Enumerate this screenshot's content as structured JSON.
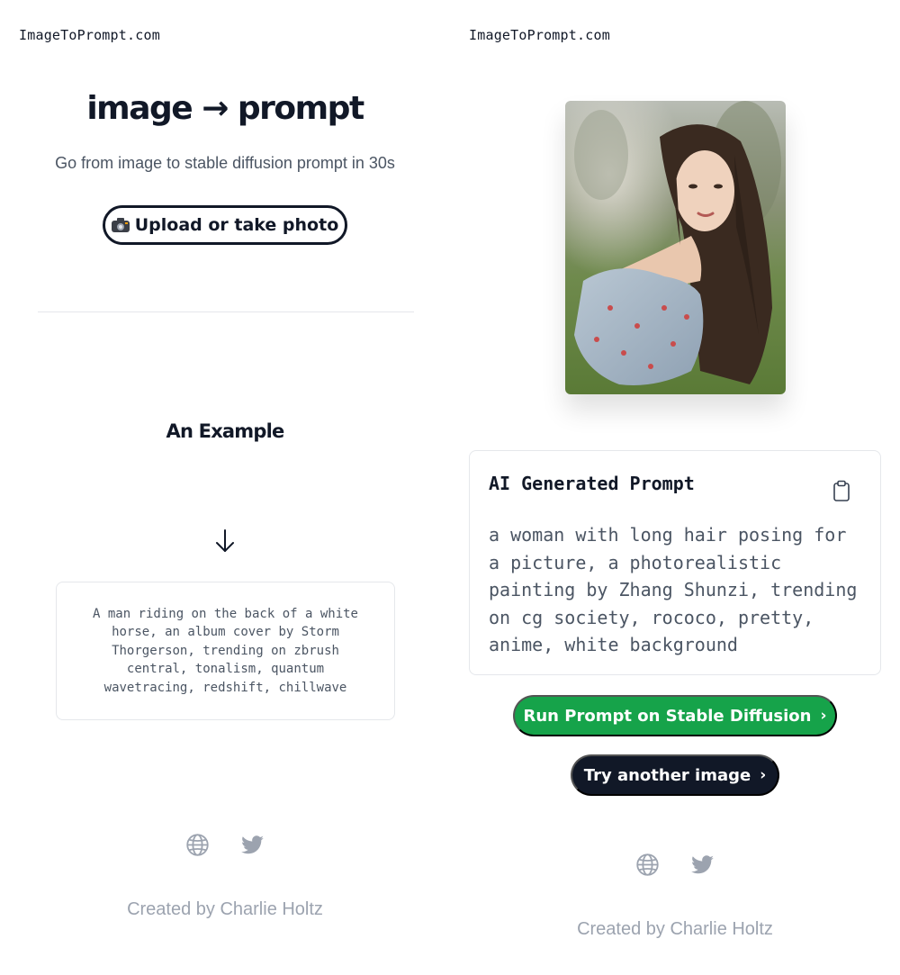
{
  "left": {
    "brand": "ImageToPrompt.com",
    "hero": {
      "title": "image → prompt",
      "subtitle": "Go from image to stable diffusion prompt in 30s",
      "upload_label": "Upload or take photo",
      "upload_icon": "camera-icon"
    },
    "example": {
      "heading": "An Example",
      "arrow_icon": "arrow-down-icon",
      "text": "A man riding on the back of a white horse, an album cover by Storm Thorgerson, trending on zbrush central, tonalism, quantum wavetracing, redshift, chillwave"
    },
    "social": [
      "globe-icon",
      "twitter-icon"
    ],
    "footer": "Created by Charlie Holtz"
  },
  "right": {
    "brand": "ImageToPrompt.com",
    "photo": {
      "subject": "woman with long dark hair in floral off-shoulder dress, outdoors"
    },
    "prompt_card": {
      "heading": "AI Generated Prompt",
      "copy_icon": "clipboard-icon",
      "text": "a woman with long hair posing for a picture, a photorealistic painting by Zhang Shunzi, trending on cg society, rococo, pretty, anime, white background"
    },
    "run_button": "Run Prompt on Stable Diffusion",
    "try_button": "Try another image",
    "chevron": "›",
    "social": [
      "globe-icon",
      "twitter-icon"
    ],
    "footer": "Created by Charlie Holtz"
  },
  "colors": {
    "text_dark": "#111827",
    "text_gray": "#4b5563",
    "footer_gray": "#9ca3af",
    "run_green": "#16a34a",
    "try_navy": "#111827",
    "border": "#e5e7eb"
  }
}
